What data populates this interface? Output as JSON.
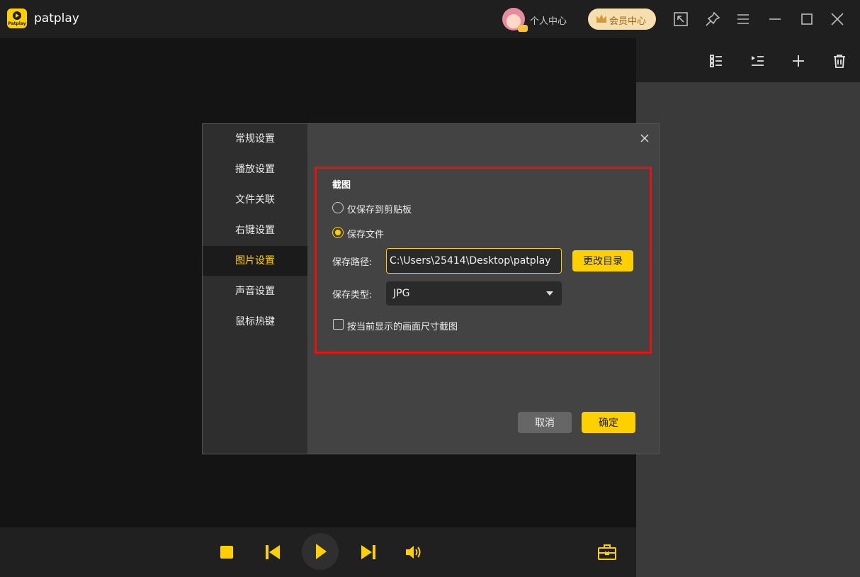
{
  "app": {
    "title": "patplay",
    "logo_text": "Patplay",
    "profile_label": "个人中心",
    "vip_label": "会员中心"
  },
  "colors": {
    "accent": "#ffd000",
    "highlight_border": "#e81010",
    "panel_bg": "#434343",
    "nav_bg": "#2e2e2e"
  },
  "dialog": {
    "nav": [
      {
        "label": "常规设置",
        "active": false
      },
      {
        "label": "播放设置",
        "active": false
      },
      {
        "label": "文件关联",
        "active": false
      },
      {
        "label": "右键设置",
        "active": false
      },
      {
        "label": "图片设置",
        "active": true
      },
      {
        "label": "声音设置",
        "active": false
      },
      {
        "label": "鼠标热键",
        "active": false
      }
    ],
    "section_title": "截图",
    "option_clipboard": "仅保存到剪贴板",
    "option_file": "保存文件",
    "selected_option": "保存文件",
    "path_label": "保存路径:",
    "path_value": "C:\\Users\\25414\\Desktop\\patplay",
    "change_dir_label": "更改目录",
    "type_label": "保存类型:",
    "type_value": "JPG",
    "checkbox_label": "按当前显示的画面尺寸截图",
    "checkbox_checked": false,
    "cancel_label": "取消",
    "ok_label": "确定"
  },
  "icons": {
    "titlebar": [
      "screen-cast-icon",
      "pin-icon",
      "menu-icon",
      "minimize-icon",
      "maximize-icon",
      "close-icon"
    ],
    "playlist": [
      "list-view-icon",
      "playlist-icon",
      "add-icon",
      "trash-icon"
    ],
    "controls": [
      "stop-icon",
      "previous-icon",
      "play-icon",
      "next-icon",
      "volume-icon",
      "toolbox-icon"
    ]
  }
}
